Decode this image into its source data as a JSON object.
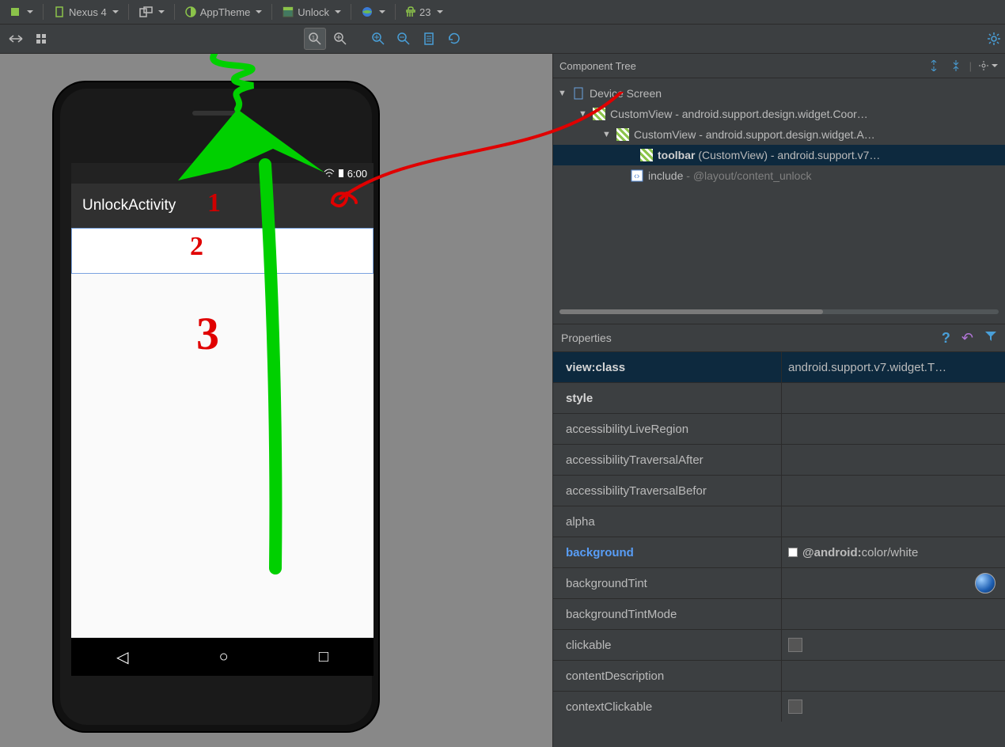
{
  "toolbar": {
    "device_label": "Nexus 4",
    "theme_label": "AppTheme",
    "layout_label": "Unlock",
    "api_label": "23"
  },
  "preview": {
    "status_time": "6:00",
    "activity_title": "UnlockActivity"
  },
  "annotations": {
    "n1": "1",
    "n2": "2",
    "n3": "3"
  },
  "component_tree": {
    "title": "Component Tree",
    "device_screen": "Device Screen",
    "row1": "CustomView - android.support.design.widget.Coor…",
    "row2": "CustomView - android.support.design.widget.A…",
    "row3_bold": "toolbar",
    "row3_rest": " (CustomView) - android.support.v7…",
    "row4_a": "include",
    "row4_b": " - @layout/content_unlock"
  },
  "properties": {
    "title": "Properties",
    "rows": [
      {
        "name": "view:class",
        "value": "android.support.v7.widget.T…",
        "bold": true,
        "first": true
      },
      {
        "name": "style",
        "value": "",
        "bold": true
      },
      {
        "name": "accessibilityLiveRegion",
        "value": ""
      },
      {
        "name": "accessibilityTraversalAfter",
        "value": ""
      },
      {
        "name": "accessibilityTraversalBefor",
        "value": ""
      },
      {
        "name": "alpha",
        "value": ""
      },
      {
        "name": "background",
        "value": "@android:color/white",
        "blue": true,
        "swatch": true,
        "boldvalue": true
      },
      {
        "name": "backgroundTint",
        "value": "",
        "sphere": true
      },
      {
        "name": "backgroundTintMode",
        "value": ""
      },
      {
        "name": "clickable",
        "value": "",
        "check": true
      },
      {
        "name": "contentDescription",
        "value": ""
      },
      {
        "name": "contextClickable",
        "value": "",
        "check": true
      }
    ]
  }
}
